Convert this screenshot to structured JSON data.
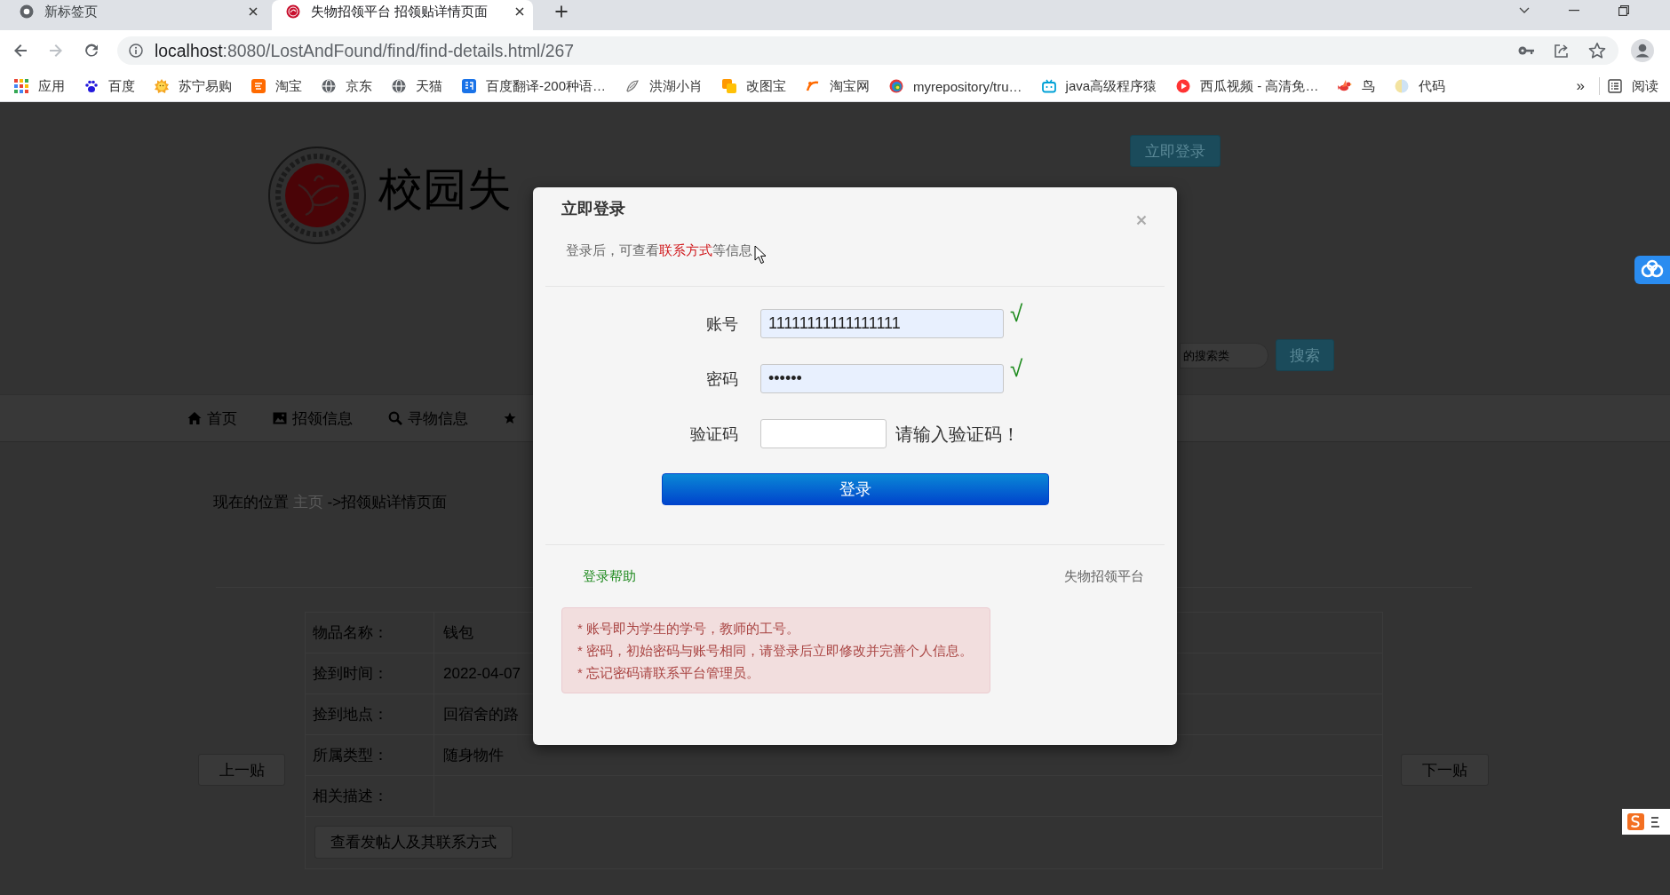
{
  "browser": {
    "tabs": [
      {
        "title": "新标签页",
        "selected": false
      },
      {
        "title": "失物招领平台 招领贴详情页面",
        "selected": true
      }
    ],
    "address": {
      "host": "localhost",
      "rest": ":8080/LostAndFound/find/find-details.html/267"
    },
    "bookmarks": [
      {
        "label": "应用"
      },
      {
        "label": "百度"
      },
      {
        "label": "苏宁易购"
      },
      {
        "label": "淘宝"
      },
      {
        "label": "京东"
      },
      {
        "label": "天猫"
      },
      {
        "label": "百度翻译-200种语…"
      },
      {
        "label": "洪湖小肖"
      },
      {
        "label": "改图宝"
      },
      {
        "label": "淘宝网"
      },
      {
        "label": "myrepository/tru…"
      },
      {
        "label": "java高级程序猿"
      },
      {
        "label": "西瓜视频 - 高清免…"
      },
      {
        "label": "鸟"
      },
      {
        "label": "代码"
      }
    ],
    "more": "»",
    "reading_list": "阅读"
  },
  "page": {
    "login_button": "立即登录",
    "site_title": "校园失",
    "search": {
      "placeholder": "的搜索类",
      "button": "搜索"
    },
    "nav": [
      {
        "label": "首页"
      },
      {
        "label": "招领信息"
      },
      {
        "label": "寻物信息"
      }
    ],
    "breadcrumb": {
      "prefix": "现在的位置",
      "link": "主页",
      "current": "->招领贴详情页面"
    },
    "details": [
      {
        "label": "物品名称：",
        "value": "钱包"
      },
      {
        "label": "捡到时间：",
        "value": "2022-04-07"
      },
      {
        "label": "捡到地点：",
        "value": "回宿舍的路"
      },
      {
        "label": "所属类型：",
        "value": "随身物件"
      },
      {
        "label": "相关描述："
      }
    ],
    "contact_button": "查看发帖人及其联系方式",
    "prev_button": "上一贴",
    "next_button": "下一贴"
  },
  "login_dialog": {
    "title": "立即登录",
    "hint": {
      "before": "登录后，可查看",
      "highlight": "联系方式",
      "after": "等信息"
    },
    "fields": [
      {
        "label": "账号",
        "kind": "text",
        "value": "11111111111111111",
        "autofilled": true,
        "valid": true,
        "message": "√"
      },
      {
        "label": "密码",
        "kind": "password",
        "value": "••••••",
        "autofilled": true,
        "valid": true,
        "message": "√"
      },
      {
        "label": "验证码",
        "kind": "captcha",
        "autofilled": false,
        "valid": false,
        "message": "请输入验证码！"
      }
    ],
    "submit": "登录",
    "help_link": "登录帮助",
    "brand": "失物招领平台",
    "notes": [
      "* 账号即为学生的学号，教师的工号。",
      "* 密码，初始密码与账号相同，请登录后立即修改并完善个人信息。",
      "* 忘记密码请联系平台管理员。"
    ]
  }
}
